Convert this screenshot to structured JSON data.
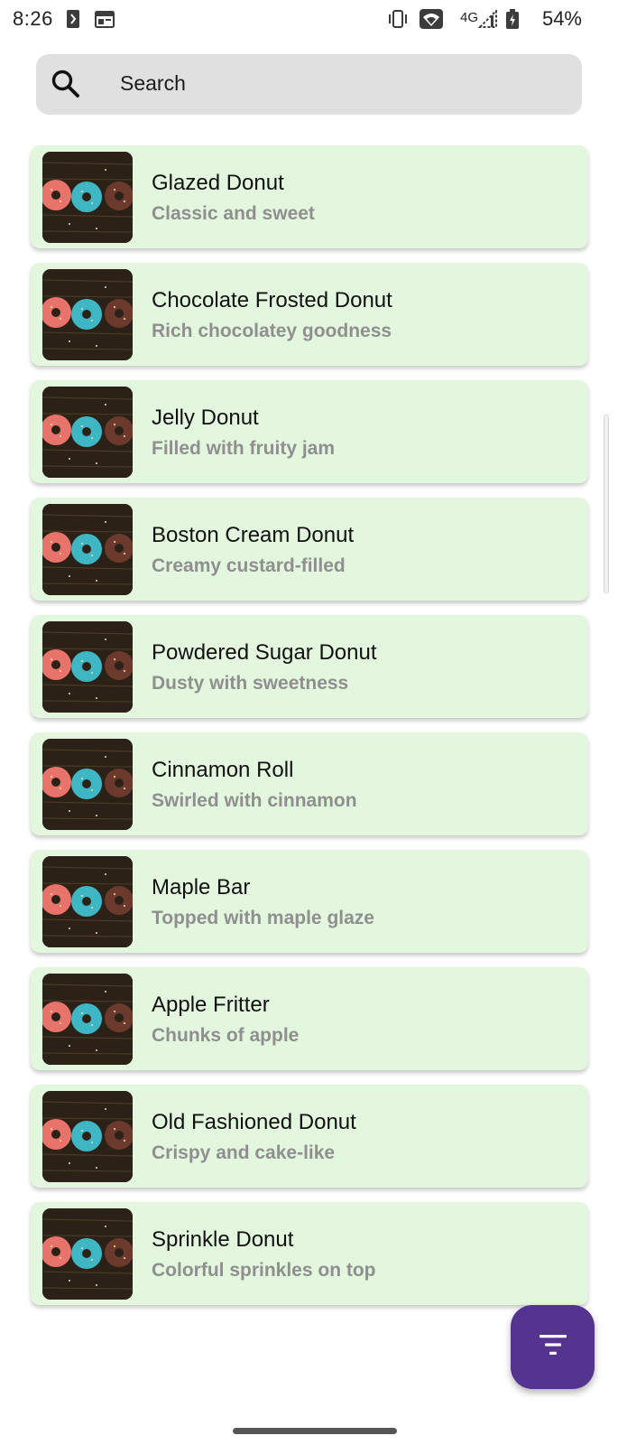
{
  "status_bar": {
    "time": "8:26",
    "network": "4G",
    "battery": "54%",
    "icons": [
      "notification-icon",
      "calendar-icon",
      "vibrate-icon",
      "wifi-icon",
      "signal-icon",
      "battery-icon"
    ]
  },
  "search": {
    "placeholder": "Search",
    "icon": "search-icon"
  },
  "items": [
    {
      "title": "Glazed Donut",
      "subtitle": "Classic and sweet"
    },
    {
      "title": "Chocolate Frosted Donut",
      "subtitle": "Rich chocolatey goodness"
    },
    {
      "title": "Jelly Donut",
      "subtitle": "Filled with fruity jam"
    },
    {
      "title": "Boston Cream Donut",
      "subtitle": "Creamy custard-filled"
    },
    {
      "title": "Powdered Sugar Donut",
      "subtitle": "Dusty with sweetness"
    },
    {
      "title": "Cinnamon Roll",
      "subtitle": "Swirled with cinnamon"
    },
    {
      "title": "Maple Bar",
      "subtitle": "Topped with maple glaze"
    },
    {
      "title": "Apple Fritter",
      "subtitle": "Chunks of apple"
    },
    {
      "title": "Old Fashioned Donut",
      "subtitle": "Crispy and cake-like"
    },
    {
      "title": "Sprinkle Donut",
      "subtitle": "Colorful sprinkles on top"
    }
  ],
  "fab": {
    "icon": "filter-icon"
  },
  "colors": {
    "card_background": "#e3f6de",
    "subtitle": "#8f8f8f",
    "fab": "#55348f",
    "search_background": "#e0e0e0"
  }
}
